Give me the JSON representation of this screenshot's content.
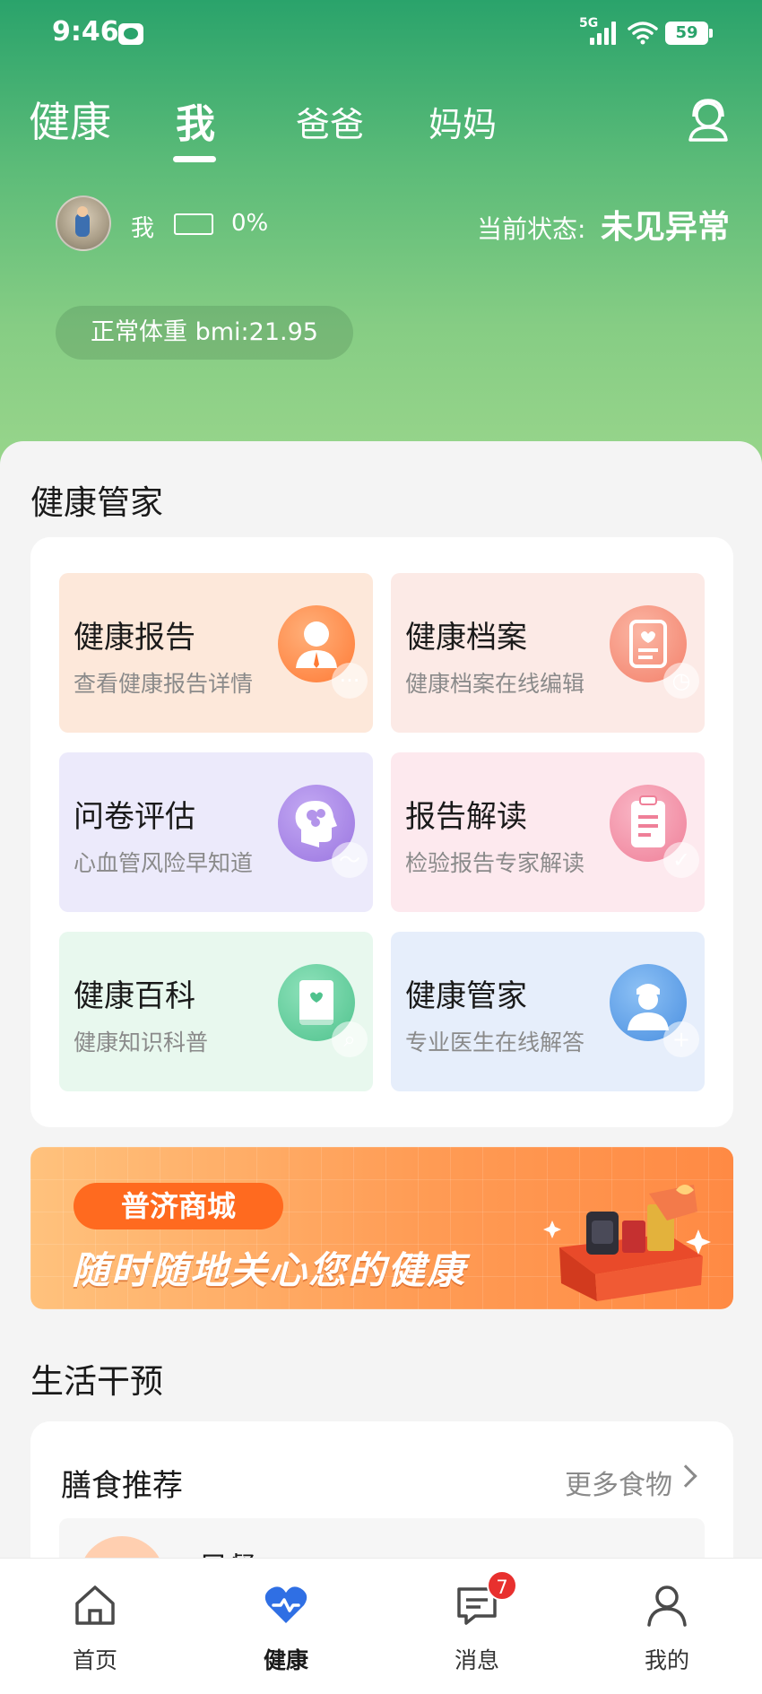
{
  "status_bar": {
    "time": "9:46",
    "network": "5G",
    "battery": "59",
    "icons": [
      "wechat-icon",
      "signal-icon",
      "wifi-icon",
      "battery-icon"
    ]
  },
  "header": {
    "tabs": [
      {
        "label": "健康",
        "active": false
      },
      {
        "label": "我",
        "active": true
      },
      {
        "label": "爸爸",
        "active": false
      },
      {
        "label": "妈妈",
        "active": false
      }
    ],
    "service_icon": "customer-service-icon"
  },
  "profile": {
    "name": "我",
    "device_percent": "0%",
    "state_label": "当前状态:",
    "state_value": "未见异常",
    "bmi_text": "正常体重 bmi:21.95"
  },
  "health_manager": {
    "section_title": "健康管家",
    "tiles": [
      {
        "title": "健康报告",
        "subtitle": "查看健康报告详情",
        "icon": "person-report-icon",
        "bg": "#fde8da",
        "icon_color": "#ff8a4c"
      },
      {
        "title": "健康档案",
        "subtitle": "健康档案在线编辑",
        "icon": "archive-icon",
        "bg": "#fceae6",
        "icon_color": "#f79480"
      },
      {
        "title": "问卷评估",
        "subtitle": "心血管风险早知道",
        "icon": "brain-icon",
        "bg": "#eceafb",
        "icon_color": "#a787e6"
      },
      {
        "title": "报告解读",
        "subtitle": "检验报告专家解读",
        "icon": "clipboard-check-icon",
        "bg": "#fde9ee",
        "icon_color": "#f48ca2"
      },
      {
        "title": "健康百科",
        "subtitle": "健康知识科普",
        "icon": "book-search-icon",
        "bg": "#e8f8ee",
        "icon_color": "#5fcf9a"
      },
      {
        "title": "健康管家",
        "subtitle": "专业医生在线解答",
        "icon": "doctor-plus-icon",
        "bg": "#e6eefb",
        "icon_color": "#5aa0ea"
      }
    ]
  },
  "banner": {
    "pill": "普济商城",
    "slogan": "随时随地关心您的健康"
  },
  "lifestyle": {
    "section_title": "生活干预",
    "diet_title": "膳食推荐",
    "more_label": "更多食物",
    "meal_name": "早餐"
  },
  "bottom_nav": {
    "items": [
      {
        "label": "首页",
        "icon": "home-icon"
      },
      {
        "label": "健康",
        "icon": "heart-pulse-icon",
        "active": true
      },
      {
        "label": "消息",
        "icon": "message-icon",
        "badge": "7"
      },
      {
        "label": "我的",
        "icon": "user-icon"
      }
    ]
  }
}
